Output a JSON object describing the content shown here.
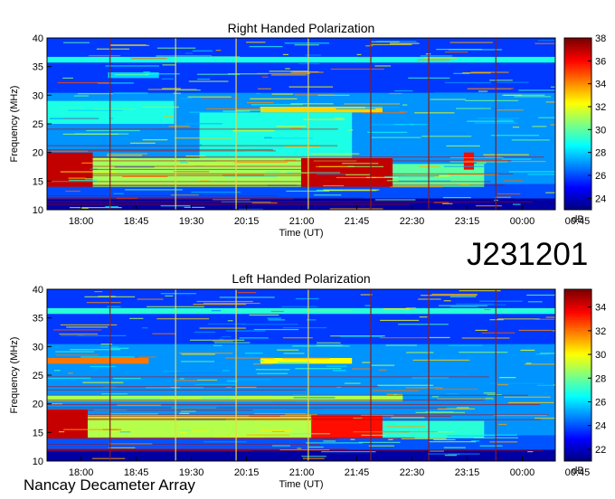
{
  "identifier": "J231201",
  "observatory": "Nancay Decameter Array",
  "chart_data": [
    {
      "type": "heatmap",
      "title": "Right Handed Polarization",
      "xlabel": "Time (UT)",
      "ylabel": "Frequency (MHz)",
      "x_ticks": [
        "18:00",
        "18:45",
        "19:30",
        "20:15",
        "21:00",
        "21:45",
        "22:30",
        "23:15",
        "00:00",
        "00:45"
      ],
      "y_ticks": [
        10,
        15,
        20,
        25,
        30,
        35,
        40
      ],
      "ylim": [
        10,
        40
      ],
      "colorbar": {
        "label": "dB",
        "range": [
          23,
          38
        ],
        "ticks": [
          24,
          26,
          28,
          30,
          32,
          34,
          36,
          38
        ]
      },
      "features": [
        {
          "kind": "band",
          "f_lo": 10,
          "f_hi": 12,
          "level": 23.5,
          "t0": 0,
          "t1": 1
        },
        {
          "kind": "band",
          "f_lo": 12,
          "f_hi": 14.5,
          "level": 26,
          "t0": 0,
          "t1": 1
        },
        {
          "kind": "band",
          "f_lo": 14,
          "f_hi": 20,
          "level": 37,
          "t0": 0,
          "t1": 0.09
        },
        {
          "kind": "band",
          "f_lo": 14,
          "f_hi": 19,
          "level": 31,
          "t0": 0.09,
          "t1": 0.5
        },
        {
          "kind": "band",
          "f_lo": 14,
          "f_hi": 19,
          "level": 37,
          "t0": 0.5,
          "t1": 0.68
        },
        {
          "kind": "band",
          "f_lo": 14,
          "f_hi": 18,
          "level": 30,
          "t0": 0.68,
          "t1": 0.86
        },
        {
          "kind": "band",
          "f_lo": 27,
          "f_hi": 28.5,
          "level": 34,
          "t0": 0,
          "t1": 0.22
        },
        {
          "kind": "band",
          "f_lo": 25,
          "f_hi": 29,
          "level": 29,
          "t0": 0,
          "t1": 0.25
        },
        {
          "kind": "band",
          "f_lo": 27,
          "f_hi": 28,
          "level": 33,
          "t0": 0.42,
          "t1": 0.66
        },
        {
          "kind": "band",
          "f_lo": 35.7,
          "f_hi": 36.7,
          "level": 29,
          "t0": 0,
          "t1": 1
        },
        {
          "kind": "band",
          "f_lo": 33,
          "f_hi": 34,
          "level": 28,
          "t0": 0.12,
          "t1": 0.22
        },
        {
          "kind": "band",
          "f_lo": 19,
          "f_hi": 27,
          "level": 29,
          "t0": 0.3,
          "t1": 0.6
        },
        {
          "kind": "band",
          "f_lo": 17,
          "f_hi": 20,
          "level": 36,
          "t0": 0.82,
          "t1": 0.84
        }
      ]
    },
    {
      "type": "heatmap",
      "title": "Left Handed Polarization",
      "xlabel": "Time (UT)",
      "ylabel": "Frequency (MHz)",
      "x_ticks": [
        "18:00",
        "18:45",
        "19:30",
        "20:15",
        "21:00",
        "21:45",
        "22:30",
        "23:15",
        "00:00",
        "00:45"
      ],
      "y_ticks": [
        10,
        15,
        20,
        25,
        30,
        35,
        40
      ],
      "ylim": [
        10,
        40
      ],
      "colorbar": {
        "label": "dB",
        "range": [
          21,
          35.5
        ],
        "ticks": [
          22,
          24,
          26,
          28,
          30,
          32,
          34
        ]
      },
      "features": [
        {
          "kind": "band",
          "f_lo": 10,
          "f_hi": 12,
          "level": 21.5,
          "t0": 0,
          "t1": 1
        },
        {
          "kind": "band",
          "f_lo": 12,
          "f_hi": 14.5,
          "level": 24,
          "t0": 0,
          "t1": 1
        },
        {
          "kind": "band",
          "f_lo": 14,
          "f_hi": 19,
          "level": 34.5,
          "t0": 0,
          "t1": 0.08
        },
        {
          "kind": "band",
          "f_lo": 14,
          "f_hi": 18,
          "level": 29,
          "t0": 0.08,
          "t1": 0.52
        },
        {
          "kind": "band",
          "f_lo": 14,
          "f_hi": 18,
          "level": 33.5,
          "t0": 0.52,
          "t1": 0.66
        },
        {
          "kind": "band",
          "f_lo": 14,
          "f_hi": 17,
          "level": 27,
          "t0": 0.66,
          "t1": 0.86
        },
        {
          "kind": "band",
          "f_lo": 27,
          "f_hi": 28,
          "level": 32,
          "t0": 0,
          "t1": 0.2
        },
        {
          "kind": "band",
          "f_lo": 27,
          "f_hi": 28,
          "level": 30,
          "t0": 0.42,
          "t1": 0.6
        },
        {
          "kind": "band",
          "f_lo": 35.7,
          "f_hi": 36.7,
          "level": 27,
          "t0": 0,
          "t1": 1
        },
        {
          "kind": "band",
          "f_lo": 20.5,
          "f_hi": 21.5,
          "level": 29,
          "t0": 0,
          "t1": 0.7
        }
      ]
    }
  ],
  "vertical_markers_time_frac": [
    {
      "t": 0.124,
      "color": "#8b1a1a"
    },
    {
      "t": 0.253,
      "color": "#e8d84a"
    },
    {
      "t": 0.372,
      "color": "#e8d84a"
    },
    {
      "t": 0.514,
      "color": "#e8d84a"
    },
    {
      "t": 0.637,
      "color": "#8b1a1a"
    },
    {
      "t": 0.751,
      "color": "#8b1a1a"
    },
    {
      "t": 0.883,
      "color": "#8b1a1a"
    }
  ]
}
